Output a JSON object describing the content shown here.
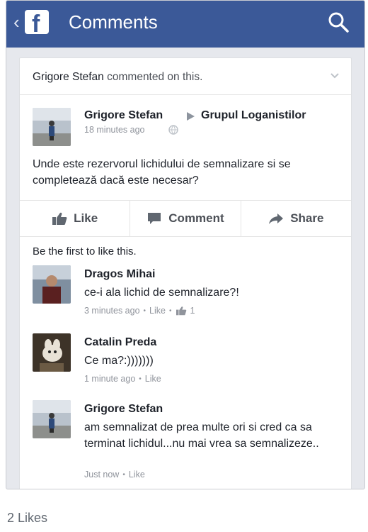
{
  "topbar": {
    "logo": "f",
    "title": "Comments",
    "back_icon": "chevron-left-icon",
    "search_icon": "search-icon",
    "color": "#3b5998"
  },
  "story": {
    "header_name": "Grigore Stefan",
    "header_action": "commented on this.",
    "author": "Grigore Stefan",
    "group": "Grupul Loganistilor",
    "time": "18 minutes ago",
    "text": "Unde este rezervorul lichidului de semnalizare si se completează dacă este necesar?"
  },
  "actions": {
    "like": "Like",
    "comment": "Comment",
    "share": "Share"
  },
  "first_like": "Be the first to like this.",
  "comments": [
    {
      "name": "Dragos Mihai",
      "text": "ce-i ala lichid de semnalizare?!",
      "time": "3 minutes ago",
      "like": "Like",
      "likes": "1"
    },
    {
      "name": "Catalin Preda",
      "text": "Ce ma?:)))))))",
      "time": "1 minute ago",
      "like": "Like"
    },
    {
      "name": "Grigore Stefan",
      "text": "am semnalizat de prea multe ori si cred ca sa terminat lichidul...nu mai vrea sa semnalizeze..",
      "time": "Just now",
      "like": "Like"
    }
  ],
  "footer": {
    "likes": "2 Likes"
  }
}
